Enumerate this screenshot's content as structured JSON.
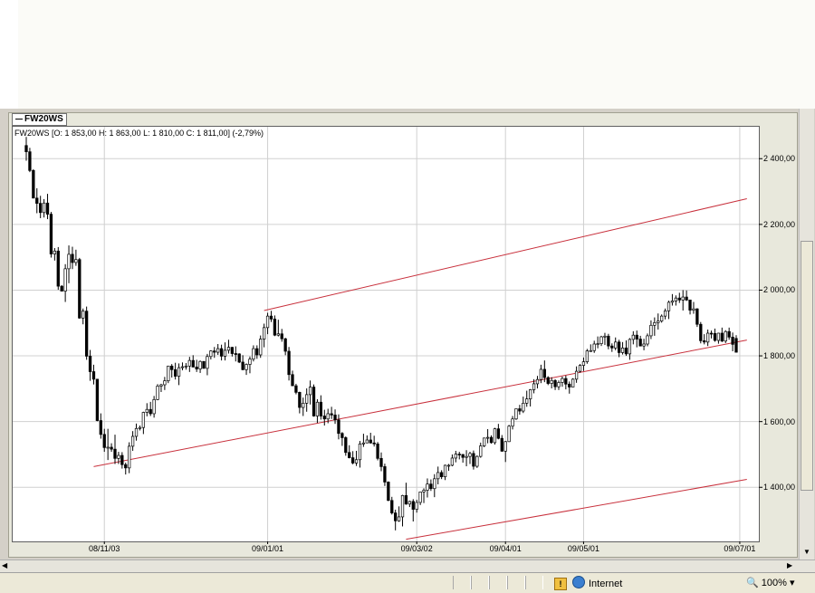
{
  "series_tab": "FW20WS",
  "ohlc_info": "FW20WS [O: 1 853,00  H: 1 863,00  L: 1 810,00  C: 1 811,00] (-2,79%)",
  "status": {
    "zone": "Internet",
    "zoom": "100%"
  },
  "colors": {
    "up": "#ffffff",
    "down": "#000000",
    "channel": "#c8303c",
    "grid": "#d0d0d0"
  },
  "icons": {
    "zone": "globe-icon",
    "zoom": "zoom-icon",
    "warning": "warning-icon"
  },
  "chart_data": {
    "type": "candlestick",
    "title": "FW20WS",
    "last_bar": {
      "open": 1853.0,
      "high": 1863.0,
      "low": 1810.0,
      "close": 1811.0,
      "change_pct": -2.79
    },
    "x_ticks": [
      {
        "label": "08/11/03",
        "index": 22
      },
      {
        "label": "09/01/01",
        "index": 68
      },
      {
        "label": "09/03/02",
        "index": 110
      },
      {
        "label": "09/04/01",
        "index": 135
      },
      {
        "label": "09/05/01",
        "index": 157
      },
      {
        "label": "09/07/01",
        "index": 201
      }
    ],
    "y_ticks": [
      {
        "value": 1400,
        "label": "1 400,00"
      },
      {
        "value": 1600,
        "label": "1 600,00"
      },
      {
        "value": 1800,
        "label": "1 800,00"
      },
      {
        "value": 2000,
        "label": "2 000,00"
      },
      {
        "value": 2200,
        "label": "2 200,00"
      },
      {
        "value": 2400,
        "label": "2 400,00"
      }
    ],
    "ylim": [
      1220,
      2450
    ],
    "bar_count": 203,
    "grid": true,
    "candles": [
      [
        2440,
        2466,
        2394,
        2421
      ],
      [
        2421,
        2433,
        2359,
        2364
      ],
      [
        2364,
        2368,
        2280,
        2280
      ],
      [
        2280,
        2310,
        2234,
        2264
      ],
      [
        2264,
        2287,
        2219,
        2236
      ],
      [
        2236,
        2277,
        2221,
        2265
      ],
      [
        2265,
        2293,
        2216,
        2231
      ],
      [
        2231,
        2238,
        2099,
        2110
      ],
      [
        2110,
        2128,
        2090,
        2119
      ],
      [
        2119,
        2131,
        2001,
        2012
      ],
      [
        2012,
        2015,
        1997,
        1997
      ],
      [
        1997,
        2079,
        1964,
        2065
      ],
      [
        2065,
        2136,
        2021,
        2109
      ],
      [
        2109,
        2132,
        2064,
        2084
      ],
      [
        2084,
        2123,
        2074,
        2093
      ],
      [
        2093,
        2098,
        1913,
        1915
      ],
      [
        1915,
        1944,
        1896,
        1936
      ],
      [
        1936,
        1950,
        1788,
        1799
      ],
      [
        1799,
        1818,
        1724,
        1752
      ],
      [
        1752,
        1773,
        1713,
        1729
      ],
      [
        1729,
        1730,
        1601,
        1603
      ],
      [
        1603,
        1625,
        1548,
        1561
      ],
      [
        1561,
        1578,
        1508,
        1521
      ],
      [
        1521,
        1578,
        1483,
        1522
      ],
      [
        1522,
        1534,
        1508,
        1516
      ],
      [
        1516,
        1560,
        1471,
        1488
      ],
      [
        1488,
        1508,
        1471,
        1497
      ],
      [
        1497,
        1507,
        1457,
        1469
      ],
      [
        1469,
        1475,
        1439,
        1459
      ],
      [
        1459,
        1537,
        1443,
        1525
      ],
      [
        1525,
        1571,
        1511,
        1555
      ],
      [
        1555,
        1594,
        1542,
        1579
      ],
      [
        1579,
        1588,
        1573,
        1582
      ],
      [
        1582,
        1630,
        1562,
        1628
      ],
      [
        1628,
        1656,
        1616,
        1637
      ],
      [
        1637,
        1660,
        1617,
        1624
      ],
      [
        1624,
        1678,
        1612,
        1667
      ],
      [
        1667,
        1714,
        1665,
        1708
      ],
      [
        1708,
        1715,
        1690,
        1712
      ],
      [
        1712,
        1736,
        1696,
        1724
      ],
      [
        1724,
        1770,
        1717,
        1769
      ],
      [
        1769,
        1775,
        1734,
        1758
      ],
      [
        1758,
        1779,
        1728,
        1738
      ],
      [
        1738,
        1777,
        1711,
        1764
      ],
      [
        1764,
        1780,
        1756,
        1767
      ],
      [
        1767,
        1778,
        1758,
        1769
      ],
      [
        1769,
        1797,
        1751,
        1786
      ],
      [
        1786,
        1802,
        1765,
        1766
      ],
      [
        1766,
        1788,
        1751,
        1760
      ],
      [
        1760,
        1786,
        1748,
        1783
      ],
      [
        1783,
        1784,
        1761,
        1762
      ],
      [
        1762,
        1806,
        1741,
        1798
      ],
      [
        1798,
        1817,
        1789,
        1815
      ],
      [
        1815,
        1827,
        1794,
        1811
      ],
      [
        1811,
        1836,
        1803,
        1822
      ],
      [
        1822,
        1834,
        1786,
        1799
      ],
      [
        1799,
        1841,
        1786,
        1817
      ],
      [
        1817,
        1849,
        1807,
        1826
      ],
      [
        1826,
        1827,
        1798,
        1807
      ],
      [
        1807,
        1829,
        1783,
        1806
      ],
      [
        1806,
        1808,
        1778,
        1781
      ],
      [
        1781,
        1802,
        1756,
        1758
      ],
      [
        1758,
        1777,
        1742,
        1774
      ],
      [
        1774,
        1798,
        1747,
        1790
      ],
      [
        1790,
        1832,
        1783,
        1822
      ],
      [
        1822,
        1832,
        1791,
        1803
      ],
      [
        1803,
        1862,
        1794,
        1851
      ],
      [
        1851,
        1898,
        1826,
        1886
      ],
      [
        1886,
        1931,
        1866,
        1921
      ],
      [
        1921,
        1937,
        1903,
        1912
      ],
      [
        1912,
        1923,
        1860,
        1863
      ],
      [
        1863,
        1910,
        1859,
        1867
      ],
      [
        1867,
        1882,
        1843,
        1852
      ],
      [
        1852,
        1855,
        1802,
        1814
      ],
      [
        1814,
        1827,
        1725,
        1743
      ],
      [
        1743,
        1755,
        1708,
        1709
      ],
      [
        1709,
        1715,
        1683,
        1689
      ],
      [
        1689,
        1691,
        1625,
        1643
      ],
      [
        1643,
        1673,
        1617,
        1656
      ],
      [
        1656,
        1701,
        1630,
        1682
      ],
      [
        1682,
        1725,
        1652,
        1705
      ],
      [
        1705,
        1713,
        1615,
        1617
      ],
      [
        1617,
        1668,
        1596,
        1659
      ],
      [
        1659,
        1680,
        1606,
        1617
      ],
      [
        1617,
        1636,
        1588,
        1608
      ],
      [
        1608,
        1639,
        1595,
        1624
      ],
      [
        1624,
        1645,
        1608,
        1620
      ],
      [
        1620,
        1637,
        1593,
        1605
      ],
      [
        1605,
        1622,
        1546,
        1564
      ],
      [
        1564,
        1568,
        1526,
        1551
      ],
      [
        1551,
        1555,
        1496,
        1506
      ],
      [
        1506,
        1528,
        1488,
        1490
      ],
      [
        1490,
        1510,
        1470,
        1474
      ],
      [
        1474,
        1511,
        1465,
        1484
      ],
      [
        1484,
        1541,
        1460,
        1532
      ],
      [
        1532,
        1563,
        1523,
        1535
      ],
      [
        1535,
        1558,
        1535,
        1544
      ],
      [
        1544,
        1566,
        1533,
        1535
      ],
      [
        1535,
        1557,
        1524,
        1532
      ],
      [
        1532,
        1538,
        1482,
        1488
      ],
      [
        1488,
        1506,
        1449,
        1463
      ],
      [
        1463,
        1472,
        1404,
        1416
      ],
      [
        1416,
        1418,
        1358,
        1360
      ],
      [
        1360,
        1371,
        1317,
        1322
      ],
      [
        1322,
        1332,
        1269,
        1298
      ],
      [
        1298,
        1342,
        1295,
        1310
      ],
      [
        1310,
        1377,
        1281,
        1375
      ],
      [
        1375,
        1414,
        1347,
        1349
      ],
      [
        1349,
        1359,
        1340,
        1357
      ],
      [
        1357,
        1364,
        1296,
        1333
      ],
      [
        1333,
        1362,
        1323,
        1354
      ],
      [
        1354,
        1387,
        1346,
        1386
      ],
      [
        1386,
        1397,
        1352,
        1391
      ],
      [
        1391,
        1427,
        1369,
        1410
      ],
      [
        1410,
        1424,
        1389,
        1396
      ],
      [
        1396,
        1440,
        1370,
        1426
      ],
      [
        1426,
        1463,
        1409,
        1445
      ],
      [
        1445,
        1452,
        1425,
        1432
      ],
      [
        1432,
        1469,
        1422,
        1467
      ],
      [
        1467,
        1471,
        1450,
        1467
      ],
      [
        1467,
        1500,
        1464,
        1489
      ],
      [
        1489,
        1511,
        1476,
        1501
      ],
      [
        1501,
        1508,
        1485,
        1500
      ],
      [
        1500,
        1501,
        1475,
        1491
      ],
      [
        1491,
        1513,
        1464,
        1494
      ],
      [
        1494,
        1508,
        1471,
        1503
      ],
      [
        1503,
        1512,
        1454,
        1464
      ],
      [
        1464,
        1497,
        1459,
        1494
      ],
      [
        1494,
        1536,
        1490,
        1526
      ],
      [
        1526,
        1551,
        1522,
        1550
      ],
      [
        1550,
        1577,
        1534,
        1552
      ],
      [
        1552,
        1558,
        1533,
        1536
      ],
      [
        1536,
        1581,
        1530,
        1578
      ],
      [
        1578,
        1593,
        1546,
        1549
      ],
      [
        1549,
        1559,
        1508,
        1510
      ],
      [
        1510,
        1541,
        1477,
        1539
      ],
      [
        1539,
        1590,
        1538,
        1586
      ],
      [
        1586,
        1617,
        1576,
        1608
      ],
      [
        1608,
        1639,
        1605,
        1639
      ],
      [
        1639,
        1651,
        1621,
        1632
      ],
      [
        1632,
        1676,
        1626,
        1656
      ],
      [
        1656,
        1694,
        1645,
        1669
      ],
      [
        1669,
        1699,
        1646,
        1697
      ],
      [
        1697,
        1729,
        1686,
        1715
      ],
      [
        1715,
        1739,
        1701,
        1728
      ],
      [
        1728,
        1773,
        1717,
        1759
      ],
      [
        1759,
        1786,
        1720,
        1734
      ],
      [
        1734,
        1738,
        1711,
        1716
      ],
      [
        1716,
        1735,
        1701,
        1725
      ],
      [
        1725,
        1729,
        1696,
        1706
      ],
      [
        1706,
        1725,
        1696,
        1719
      ],
      [
        1719,
        1737,
        1706,
        1731
      ],
      [
        1731,
        1740,
        1698,
        1714
      ],
      [
        1714,
        1722,
        1685,
        1705
      ],
      [
        1705,
        1732,
        1705,
        1729
      ],
      [
        1729,
        1768,
        1718,
        1753
      ],
      [
        1753,
        1775,
        1749,
        1771
      ],
      [
        1771,
        1795,
        1754,
        1782
      ],
      [
        1782,
        1821,
        1776,
        1815
      ],
      [
        1815,
        1835,
        1812,
        1816
      ],
      [
        1816,
        1846,
        1809,
        1836
      ],
      [
        1836,
        1859,
        1823,
        1837
      ],
      [
        1837,
        1861,
        1830,
        1858
      ],
      [
        1858,
        1870,
        1833,
        1860
      ],
      [
        1860,
        1867,
        1820,
        1830
      ],
      [
        1830,
        1838,
        1812,
        1824
      ],
      [
        1824,
        1856,
        1817,
        1842
      ],
      [
        1842,
        1849,
        1796,
        1810
      ],
      [
        1810,
        1842,
        1804,
        1824
      ],
      [
        1824,
        1847,
        1800,
        1806
      ],
      [
        1806,
        1854,
        1788,
        1850
      ],
      [
        1850,
        1875,
        1835,
        1863
      ],
      [
        1863,
        1877,
        1826,
        1851
      ],
      [
        1851,
        1861,
        1829,
        1830
      ],
      [
        1830,
        1852,
        1817,
        1836
      ],
      [
        1836,
        1868,
        1829,
        1861
      ],
      [
        1861,
        1908,
        1851,
        1893
      ],
      [
        1893,
        1917,
        1861,
        1901
      ],
      [
        1901,
        1929,
        1880,
        1906
      ],
      [
        1906,
        1926,
        1901,
        1921
      ],
      [
        1921,
        1944,
        1911,
        1937
      ],
      [
        1937,
        1968,
        1912,
        1963
      ],
      [
        1963,
        1988,
        1953,
        1967
      ],
      [
        1967,
        1984,
        1953,
        1976
      ],
      [
        1976,
        1992,
        1961,
        1970
      ],
      [
        1970,
        2000,
        1938,
        1979
      ],
      [
        1979,
        1999,
        1967,
        1970
      ],
      [
        1970,
        1971,
        1926,
        1939
      ],
      [
        1939,
        1964,
        1928,
        1943
      ],
      [
        1943,
        1945,
        1888,
        1896
      ],
      [
        1896,
        1903,
        1838,
        1846
      ],
      [
        1846,
        1866,
        1835,
        1842
      ],
      [
        1842,
        1880,
        1830,
        1869
      ],
      [
        1869,
        1877,
        1853,
        1868
      ],
      [
        1868,
        1883,
        1843,
        1847
      ],
      [
        1847,
        1870,
        1837,
        1869
      ],
      [
        1869,
        1886,
        1842,
        1845
      ],
      [
        1845,
        1878,
        1839,
        1874
      ],
      [
        1874,
        1886,
        1849,
        1857
      ],
      [
        1857,
        1871,
        1814,
        1835
      ],
      [
        1853,
        1863,
        1810,
        1811
      ]
    ],
    "trend_channel": [
      {
        "start": {
          "index": 19,
          "value": 1463
        },
        "end": {
          "index": 203,
          "value": 1848
        }
      },
      {
        "start": {
          "index": 67,
          "value": 1938
        },
        "end": {
          "index": 203,
          "value": 2278
        }
      },
      {
        "start": {
          "index": 107,
          "value": 1242
        },
        "end": {
          "index": 203,
          "value": 1424
        }
      }
    ]
  }
}
